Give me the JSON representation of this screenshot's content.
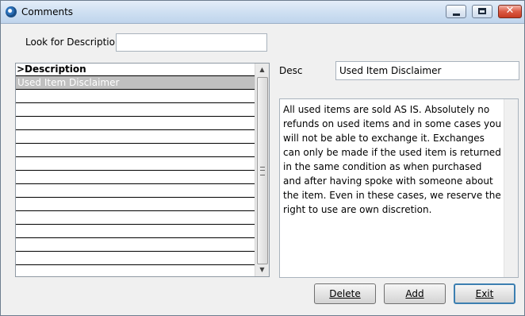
{
  "window": {
    "title": "Comments",
    "icon": "app-icon"
  },
  "search": {
    "label": "Look for Description",
    "value": ""
  },
  "grid": {
    "header": ">Description",
    "rows": [
      "Used Item Disclaimer",
      "",
      "",
      "",
      "",
      "",
      "",
      "",
      "",
      "",
      "",
      "",
      "",
      "",
      ""
    ],
    "selected_index": 0
  },
  "detail": {
    "desc_label": "Desc",
    "desc_value": "Used Item Disclaimer",
    "body_text": "All used items are sold AS IS. Absolutely no refunds on used items and in some cases you will not be able to exchange it. Exchanges can only be made if the used item is returned in the same condition as when purchased and after having spoke with someone about the item. Even in these cases, we reserve the right to use are own discretion."
  },
  "buttons": {
    "delete": "Delete",
    "add": "Add",
    "exit": "Exit"
  },
  "colors": {
    "selected_row": "#c0c0c0",
    "default_button_border": "#3c7fb1"
  }
}
